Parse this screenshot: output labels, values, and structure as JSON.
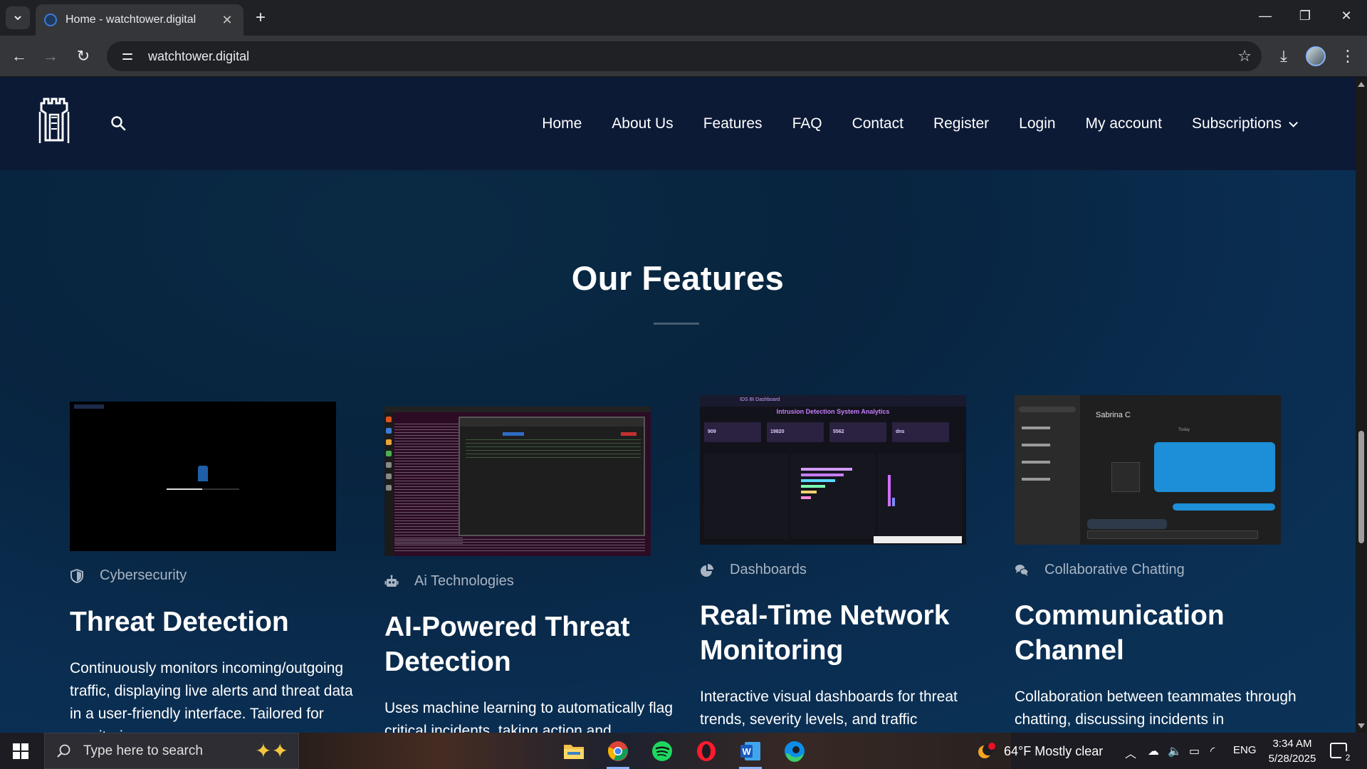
{
  "browser": {
    "tab_title": "Home - watchtower.digital",
    "url": "watchtower.digital"
  },
  "header": {
    "nav": [
      "Home",
      "About Us",
      "Features",
      "FAQ",
      "Contact",
      "Register",
      "Login",
      "My account",
      "Subscriptions"
    ]
  },
  "features": {
    "title": "Our Features",
    "cards": [
      {
        "category": "Cybersecurity",
        "icon": "shield-icon",
        "title": "Threat Detection",
        "description": "Continuously monitors incoming/outgoing traffic, displaying live alerts and threat data in a user-friendly interface. Tailored for monitoring"
      },
      {
        "category": "Ai Technologies",
        "icon": "robot-icon",
        "title": "AI-Powered Threat Detection",
        "description": "Uses machine learning to automatically flag critical incidents, taking action and"
      },
      {
        "category": "Dashboards",
        "icon": "pie-chart-icon",
        "title": "Real-Time Network Monitoring",
        "description": "Interactive visual dashboards for threat trends, severity levels, and traffic"
      },
      {
        "category": "Collaborative Chatting",
        "icon": "chat-bubbles-icon",
        "title": "Communication Channel",
        "description": "Collaboration between teammates through chatting, discussing incidents in"
      }
    ],
    "screenshot_texts": {
      "dashboard_header": "IDS BI Dashboard",
      "dashboard_title": "Intrusion Detection System Analytics",
      "kpis": [
        "909",
        "19820",
        "5562",
        "dns"
      ],
      "chat_contact": "Sabrina C",
      "chat_day": "Today"
    }
  },
  "taskbar": {
    "search_placeholder": "Type here to search",
    "weather": "64°F  Mostly clear",
    "language": "ENG",
    "time": "3:34 AM",
    "date": "5/28/2025",
    "notifications": "2"
  }
}
